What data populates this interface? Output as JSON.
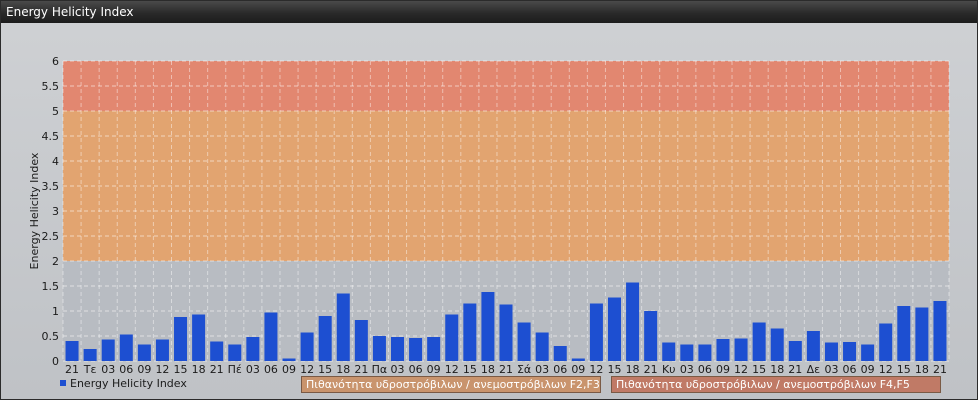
{
  "window": {
    "title": "Energy Helicity Index"
  },
  "colors": {
    "bar": "#1d4fd1",
    "band_low": "#b8bcc2",
    "band_mid": "#e2a470",
    "band_high": "#e28770",
    "grid": "#ffffff"
  },
  "legend": {
    "series": "Energy Helicity Index",
    "band_f2f3": "Πιθανότητα υδροστρόβιλων / ανεμοστρόβιλων F2,F3",
    "band_f4f5": "Πιθανότητα υδροστρόβιλων / ανεμοστρόβιλων F4,F5"
  },
  "chart_data": {
    "type": "bar",
    "title": "",
    "xlabel": "",
    "ylabel": "Energy Helicity Index",
    "ylim": [
      0,
      6
    ],
    "yticks": [
      "0",
      "0.5",
      "1",
      "1.5",
      "2",
      "2.5",
      "3",
      "3.5",
      "4",
      "4.5",
      "5",
      "5.5",
      "6"
    ],
    "grid": true,
    "legend_position": "bottom-left",
    "bands": [
      {
        "from": 0,
        "to": 2,
        "color": "#b8bcc2"
      },
      {
        "from": 2,
        "to": 5,
        "color": "#e2a470",
        "label": "Πιθανότητα υδροστρόβιλων / ανεμοστρόβιλων F2,F3"
      },
      {
        "from": 5,
        "to": 6,
        "color": "#e28770",
        "label": "Πιθανότητα υδροστρόβιλων / ανεμοστρόβιλων F4,F5"
      }
    ],
    "categories": [
      "21",
      "Τε",
      "03",
      "06",
      "09",
      "12",
      "15",
      "18",
      "21",
      "Πέ",
      "03",
      "06",
      "09",
      "12",
      "15",
      "18",
      "21",
      "Πα",
      "03",
      "06",
      "09",
      "12",
      "15",
      "18",
      "21",
      "Σά",
      "03",
      "06",
      "09",
      "12",
      "15",
      "18",
      "21",
      "Κυ",
      "03",
      "06",
      "09",
      "12",
      "15",
      "18",
      "21",
      "Δε",
      "03",
      "06",
      "09",
      "12",
      "15",
      "18",
      "21"
    ],
    "series": [
      {
        "name": "Energy Helicity Index",
        "values": [
          0.4,
          0.24,
          0.43,
          0.53,
          0.33,
          0.43,
          0.88,
          0.93,
          0.39,
          0.33,
          0.48,
          0.97,
          0.05,
          0.57,
          0.9,
          1.35,
          0.82,
          0.5,
          0.48,
          0.46,
          0.48,
          0.93,
          1.15,
          1.38,
          1.13,
          0.77,
          0.57,
          0.3,
          0.05,
          1.15,
          1.27,
          1.57,
          1.0,
          0.37,
          0.33,
          0.33,
          0.44,
          0.45,
          0.77,
          0.65,
          0.4,
          0.6,
          0.37,
          0.38,
          0.33,
          0.75,
          1.1,
          1.07,
          1.2
        ]
      }
    ]
  }
}
